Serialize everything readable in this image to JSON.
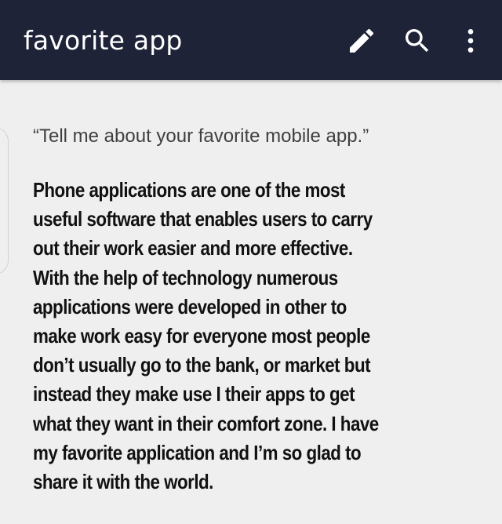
{
  "header": {
    "title": "favorite app",
    "icons": {
      "edit": "edit-pencil-icon",
      "search": "search-icon",
      "more": "more-vertical-icon"
    },
    "background_color": "#1e2338"
  },
  "content": {
    "prompt": "“Tell me about your favorite mobile app.”",
    "essay_lines": [
      "Phone applications are one of the most",
      "useful software that enables users to carry",
      "out their work easier and more effective.",
      "With the help of technology numerous",
      "applications were developed in other to",
      "make work easy for everyone most people",
      "don’t usually go to the bank, or market but",
      "instead they make use I their apps to get",
      "what they want in their comfort zone. I have",
      "my favorite application and I’m so glad to",
      "share it with the world."
    ]
  }
}
